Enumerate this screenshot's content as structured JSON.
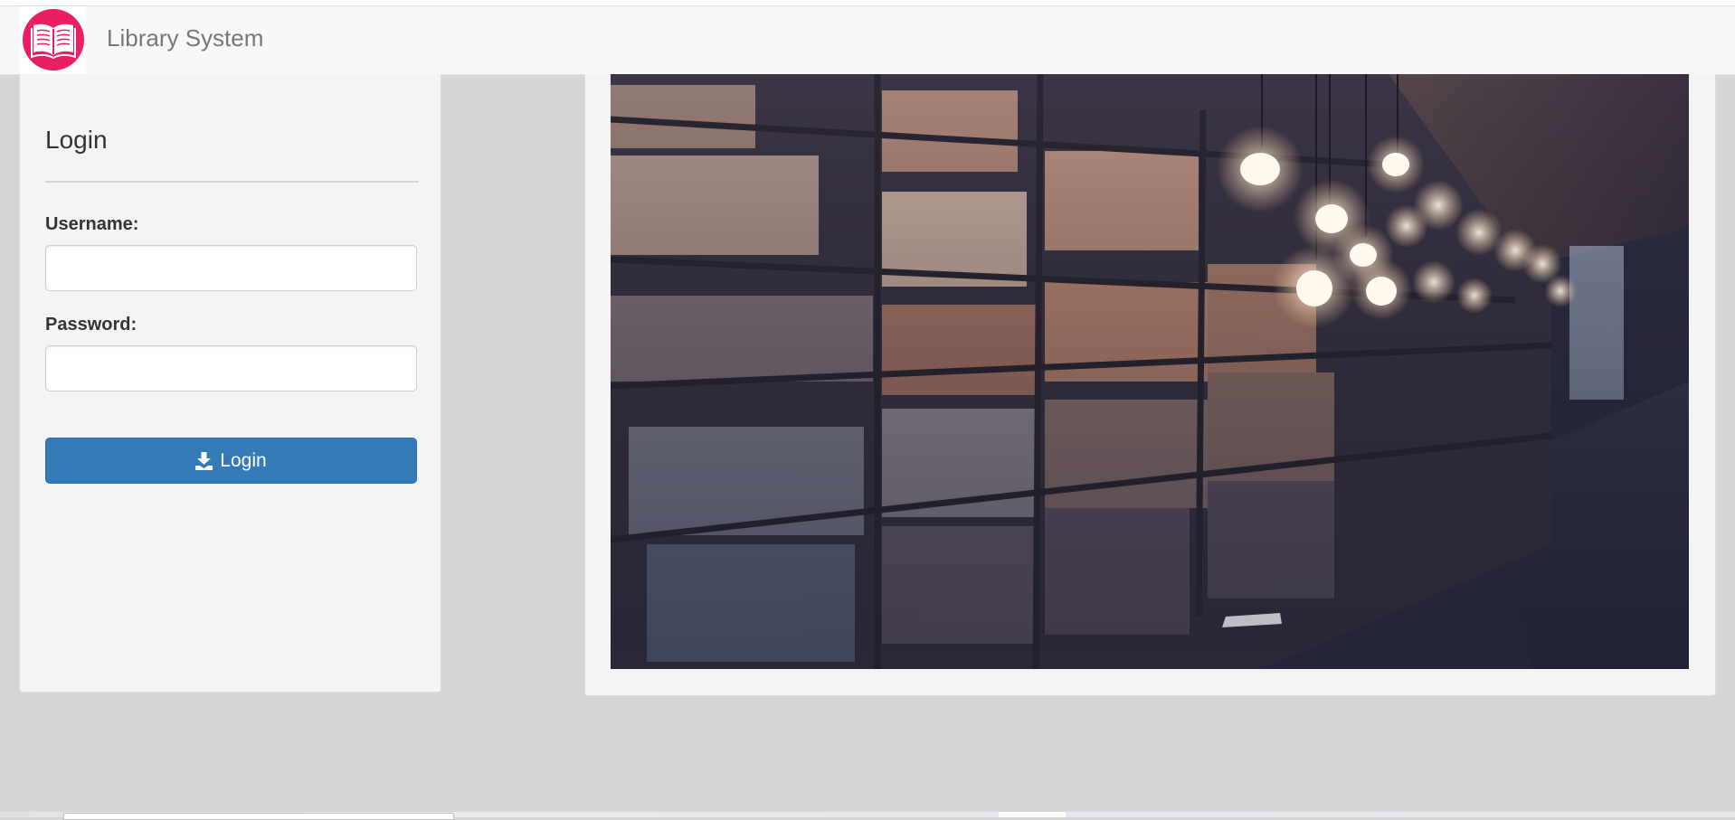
{
  "navbar": {
    "brand": "Library System",
    "logo_icon": "open-book-icon",
    "logo_color": "#e91e63"
  },
  "login": {
    "title": "Login",
    "username_label": "Username:",
    "username_value": "",
    "password_label": "Password:",
    "password_value": "",
    "button_label": "Login",
    "button_icon": "download-icon",
    "button_color": "#337ab7"
  },
  "hero_image": {
    "subject": "library-bookshelves-photo"
  }
}
